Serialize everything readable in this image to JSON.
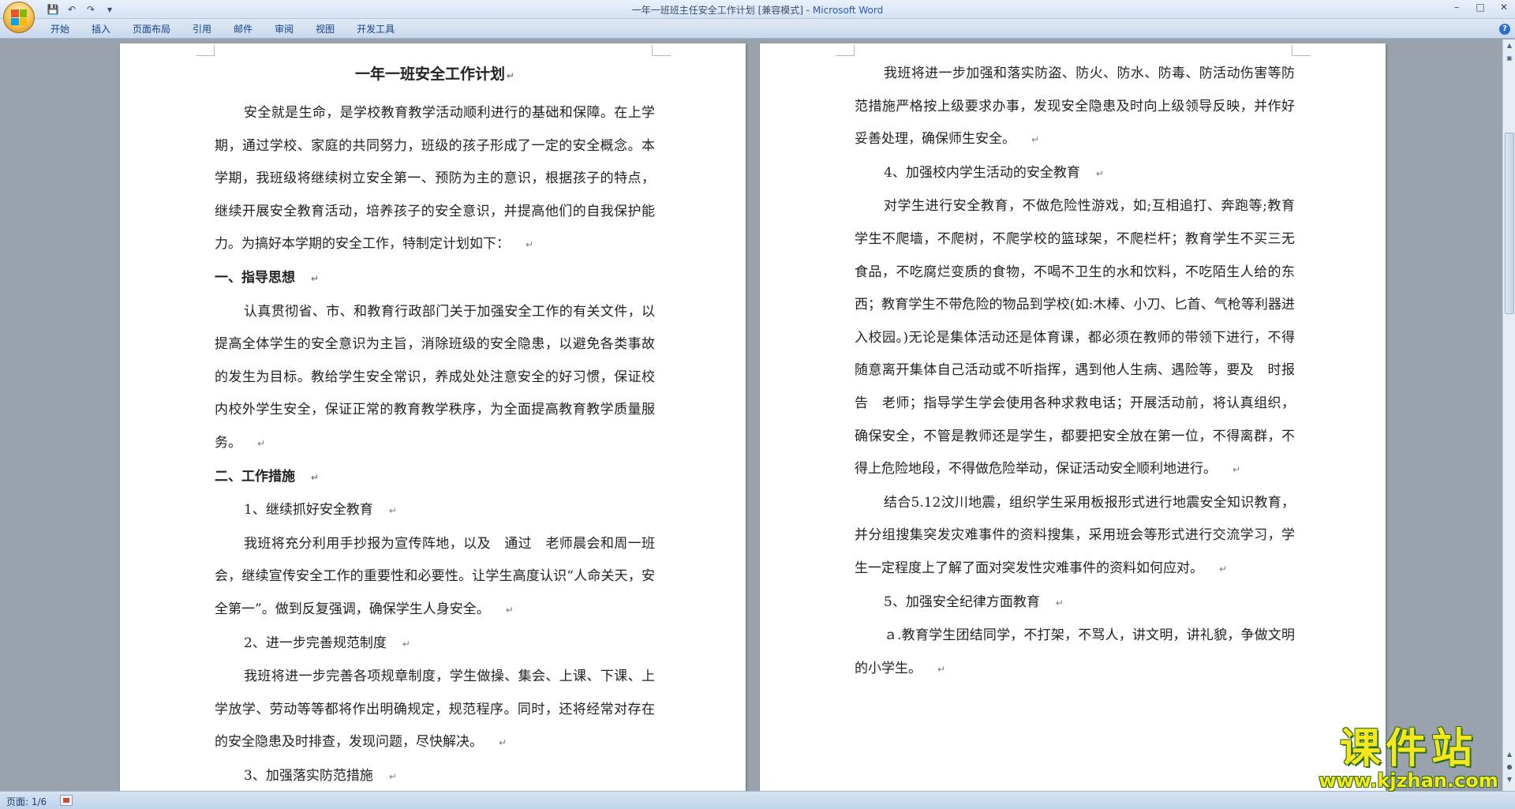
{
  "window": {
    "title": "一年一班班主任安全工作计划 [兼容模式] - ",
    "app_name": "Microsoft Word"
  },
  "colors": {
    "ribbon_text": "#15428b",
    "watermark_fill": "#f4e81a",
    "watermark_outline": "#2a6b1f"
  },
  "quick_access": {
    "save_icon": "save-icon",
    "undo_icon": "undo-icon",
    "redo_icon": "redo-icon",
    "customize_icon": "dropdown-arrow-icon"
  },
  "ribbon": {
    "tabs": [
      "开始",
      "插入",
      "页面布局",
      "引用",
      "邮件",
      "审阅",
      "视图",
      "开发工具"
    ]
  },
  "document": {
    "left_page": {
      "title": "一年一班安全工作计划",
      "intro": "安全就是生命，是学校教育教学活动顺利进行的基础和保障。在上学期，通过学校、家庭的共同努力，班级的孩子形成了一定的安全概念。本学期，我班级将继续树立安全第一、预防为主的意识，根据孩子的特点，继续开展安全教育活动，培养孩子的安全意识，并提高他们的自我保护能力。为搞好本学期的安全工作，特制定计划如下：",
      "heading1": "一、指导思想",
      "para1": "认真贯彻省、市、和教育行政部门关于加强安全工作的有关文件，以提高全体学生的安全意识为主旨，消除班级的安全隐患，以避免各类事故的发生为目标。教给学生安全常识，养成处处注意安全的好习惯，保证校内校外学生安全，保证正常的教育教学秩序，为全面提高教育教学质量服务。",
      "heading2": "二、工作措施",
      "sub1": "1、继续抓好安全教育",
      "para2": "我班将充分利用手抄报为宣传阵地，以及　通过　老师晨会和周一班会，继续宣传安全工作的重要性和必要性。让学生高度认识“人命关天，安全第一”。做到反复强调，确保学生人身安全。",
      "sub2": "2、进一步完善规范制度",
      "para3": "我班将进一步完善各项规章制度，学生做操、集会、上课、下课、上学放学、劳动等等都将作出明确规定，规范程序。同时，还将经常对存在的安全隐患及时排查，发现问题，尽快解决。",
      "sub3": "3、加强落实防范措施"
    },
    "right_page": {
      "para1": "我班将进一步加强和落实防盗、防火、防水、防毒、防活动伤害等防范措施严格按上级要求办事，发现安全隐患及时向上级领导反映，并作好妥善处理，确保师生安全。",
      "sub4": "4、加强校内学生活动的安全教育",
      "para2": "对学生进行安全教育，不做危险性游戏，如;互相追打、奔跑等;教育学生不爬墙，不爬树，不爬学校的篮球架，不爬栏杆；教育学生不买三无食品，不吃腐烂变质的食物，不喝不卫生的水和饮料，不吃陌生人给的东西；教育学生不带危险的物品到学校(如:木棒、小刀、匕首、气枪等利器进入校园。)无论是集体活动还是体育课，都必须在教师的带领下进行，不得随意离开集体自己活动或不听指挥，遇到他人生病、遇险等，要及　时报告　老师；指导学生学会使用各种求救电话；开展活动前，将认真组织，确保安全，不管是教师还是学生，都要把安全放在第一位，不得离群，不得上危险地段，不得做危险举动，保证活动安全顺利地进行。",
      "para3": "结合5.12汶川地震，组织学生采用板报形式进行地震安全知识教育，并分组搜集突发灾难事件的资料搜集，采用班会等形式进行交流学习，学生一定程度上了解了面对突发性灾难事件的资料如何应对。",
      "sub5": "5、加强安全纪律方面教育",
      "para4": "ａ.教育学生团结同学，不打架，不骂人，讲文明，讲礼貌，争做文明的小学生。"
    },
    "paragraph_mark": "↵"
  },
  "status_bar": {
    "page_indicator": "页面: 1/6"
  },
  "watermark": {
    "main": "课件站",
    "url": "www.kjzhan.com"
  }
}
